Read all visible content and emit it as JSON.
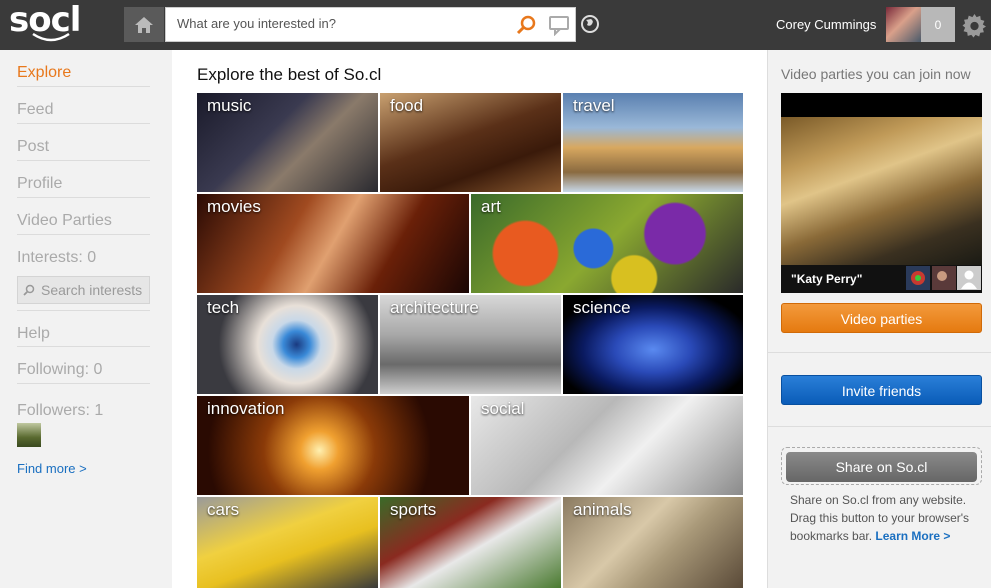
{
  "header": {
    "logo": "socl",
    "search_placeholder": "What are you interested in?",
    "user_name": "Corey Cummings",
    "notification_count": "0"
  },
  "nav": {
    "items": [
      "Explore",
      "Feed",
      "Post",
      "Profile",
      "Video Parties",
      "Interests: 0"
    ],
    "search_interests": "Search interests",
    "help": "Help",
    "following": "Following: 0",
    "followers": "Followers: 1",
    "find_more": "Find more >"
  },
  "main": {
    "title": "Explore the best of So.cl",
    "tiles": [
      "music",
      "food",
      "travel",
      "movies",
      "art",
      "tech",
      "architecture",
      "science",
      "innovation",
      "social",
      "cars",
      "sports",
      "animals"
    ]
  },
  "sidebar": {
    "title": "Video parties you can join now",
    "video_caption": "\"Katy Perry\"",
    "video_parties_button": "Video parties",
    "invite_button": "Invite friends",
    "share_button": "Share on So.cl",
    "share_desc": "Share on So.cl from any website. Drag this button to your browser's bookmarks bar.",
    "learn_more": "Learn More >"
  },
  "colors": {
    "accent_orange": "#e8781c",
    "link_blue": "#1a6fc0",
    "header_bg": "#3a3a3a"
  }
}
